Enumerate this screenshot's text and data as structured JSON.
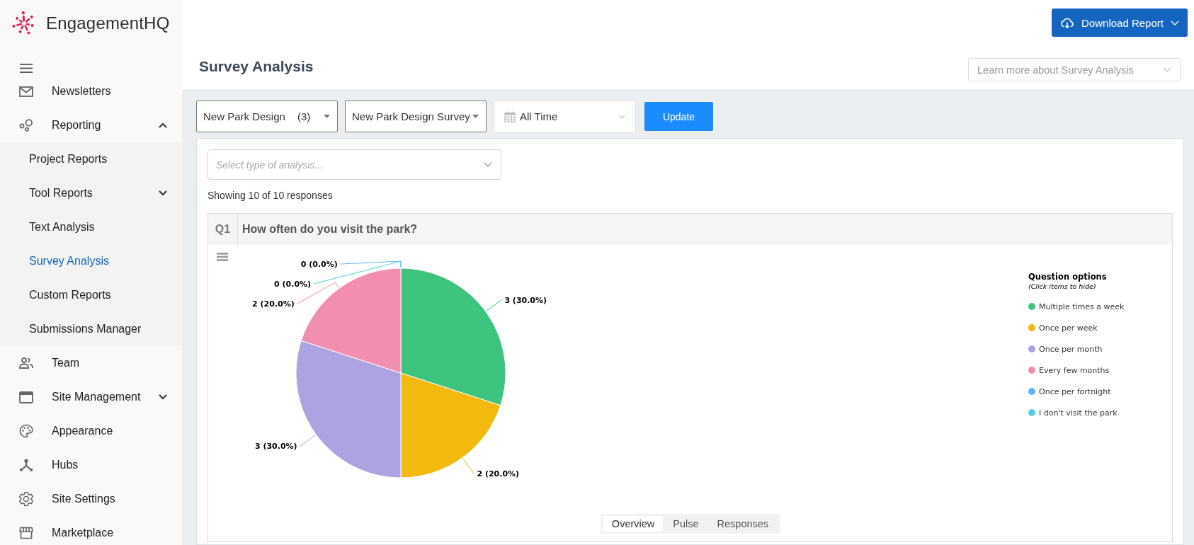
{
  "sidebar": {
    "logo": "EngagementHQ",
    "items": [
      {
        "kind": "link",
        "label": "Newsletters",
        "selected": false
      },
      {
        "kind": "group",
        "label": "Reporting",
        "selected": false,
        "expanded": true,
        "children": [
          {
            "kind": "link",
            "label": "Project Reports",
            "selected": false
          },
          {
            "kind": "group",
            "label": "Tool Reports",
            "selected": false,
            "expanded": false
          },
          {
            "kind": "link",
            "label": "Text Analysis",
            "selected": false
          },
          {
            "kind": "link",
            "label": "Survey Analysis",
            "selected": true
          },
          {
            "kind": "link",
            "label": "Custom Reports",
            "selected": false
          },
          {
            "kind": "link",
            "label": "Submissions Manager",
            "selected": false
          }
        ]
      },
      {
        "kind": "link",
        "label": "Team",
        "selected": false
      },
      {
        "kind": "group",
        "label": "Site Management",
        "selected": false,
        "expanded": false
      },
      {
        "kind": "link",
        "label": "Appearance",
        "selected": false
      },
      {
        "kind": "link",
        "label": "Hubs",
        "selected": false
      },
      {
        "kind": "link",
        "label": "Site Settings",
        "selected": false
      },
      {
        "kind": "link",
        "label": "Marketplace",
        "selected": false
      }
    ]
  },
  "header": {
    "download_button": "Download Report",
    "title": "Survey Analysis",
    "help_select": {
      "placeholder": "Learn more about Survey Analysis"
    }
  },
  "filters": {
    "selects": [
      {
        "kind": "select",
        "value": "New Park Design",
        "count": "(3)"
      },
      {
        "kind": "select",
        "value": "New Park Design Survey"
      },
      {
        "kind": "date",
        "value": "All Time"
      }
    ],
    "update_button": "Update"
  },
  "analysis": {
    "type_select": {
      "placeholder": "Select type of analysis..."
    },
    "summary": "Showing 10 of 10 responses"
  },
  "questions": [
    {
      "number": "Q1",
      "title": "How often do you visit the park?",
      "chart_data": {
        "type": "pie",
        "categories": [
          "Multiple times a week",
          "Once per week",
          "Once per month",
          "Every few months",
          "Once per fortnight",
          "I don't visit the park"
        ],
        "values": [
          3,
          2,
          3,
          2,
          0,
          0
        ],
        "colors": [
          "#3ec47e",
          "#f2b90f",
          "#aca3e3",
          "#f28fb0",
          "#63b3f5",
          "#4fcfe0"
        ],
        "value_labels": [
          "3 (30.0%)",
          "2 (20.0%)",
          "3 (30.0%)",
          "2 (20.0%)",
          "0 (0.0%)",
          "0 (0.0%)"
        ]
      },
      "legend": {
        "title": "Question options",
        "hint": "(Click items to hide)"
      },
      "tabs": [
        {
          "label": "Overview",
          "selected": true
        },
        {
          "label": "Pulse",
          "selected": false
        },
        {
          "label": "Responses",
          "selected": false
        }
      ]
    }
  ]
}
